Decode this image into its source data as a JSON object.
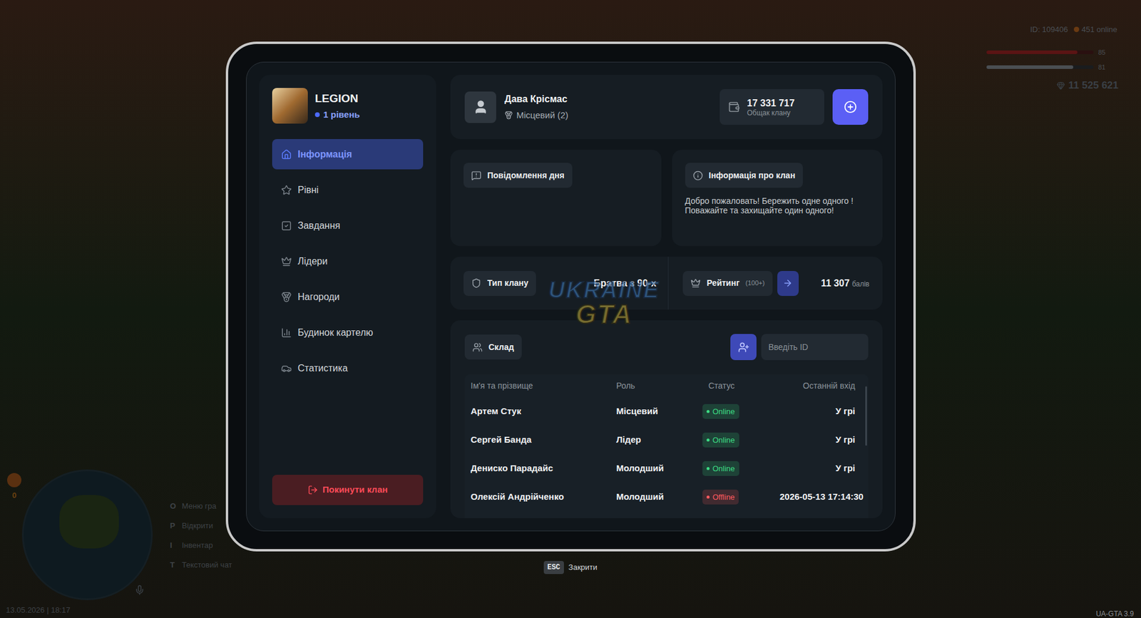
{
  "hud": {
    "id": "ID: 109406",
    "online": "451 online",
    "health": "85",
    "health_level": 0.85,
    "armor": "81",
    "armor_level": 0.81,
    "money": "11 525 621",
    "date": "13.05.2026 | 18:17",
    "version": "UA-GTA 3.9",
    "minimap_counter": "0",
    "hints": [
      {
        "key": "O",
        "label": "Меню гра"
      },
      {
        "key": "P",
        "label": "Відкрити"
      },
      {
        "key": "I",
        "label": "Інвентар"
      },
      {
        "key": "T",
        "label": "Текстовий чат"
      }
    ]
  },
  "clan": {
    "name": "LEGION",
    "level": "1 рівень"
  },
  "sidebar": {
    "items": [
      {
        "label": "Інформація",
        "selected": true
      },
      {
        "label": "Рівні",
        "selected": false
      },
      {
        "label": "Завдання",
        "selected": false
      },
      {
        "label": "Лідери",
        "selected": false
      },
      {
        "label": "Нагороди",
        "selected": false
      },
      {
        "label": "Будинок картелю",
        "selected": false
      },
      {
        "label": "Статистика",
        "selected": false
      }
    ],
    "leave_button": "Покинути клан"
  },
  "profile": {
    "name": "Дава Крісмас",
    "rank": "Місцевий (2)"
  },
  "bank": {
    "amount": "17 331 717",
    "label": "Общак клану"
  },
  "motd": {
    "title": "Повідомлення дня"
  },
  "clan_info": {
    "title": "Інформація про клан",
    "text": "Добро пожаловать! Бережить одне одного ! Поважайте та захищайте один одного!"
  },
  "clan_type": {
    "label": "Тип клану",
    "value": "Братва з 90-х"
  },
  "rating": {
    "label": "Рейтинг",
    "badge": "(100+)",
    "points": "11 307",
    "unit": "балів"
  },
  "roster": {
    "title": "Склад",
    "search_placeholder": "Введіть ID",
    "columns": [
      "Ім'я та прізвище",
      "Роль",
      "Статус",
      "Останній вхід"
    ],
    "rows": [
      {
        "name": "Артем Стук",
        "role": "Місцевий",
        "status": "Online",
        "color": "#3ddc84",
        "last_login": "У грі"
      },
      {
        "name": "Сергей Банда",
        "role": "Лідер",
        "status": "Online",
        "color": "#3ddc84",
        "last_login": "У грі"
      },
      {
        "name": "Дениско Парадайс",
        "role": "Молодший",
        "status": "Online",
        "color": "#3ddc84",
        "last_login": "У грі"
      },
      {
        "name": "Олексій Андрійченко",
        "role": "Молодший",
        "status": "Offline",
        "color": "#ff5a5f",
        "last_login": "2026-05-13 17:14:30"
      }
    ]
  },
  "watermark": {
    "line1": "UKRAINE",
    "line2": "GTA"
  },
  "footer": {
    "key": "ESC",
    "label": "Закрити"
  }
}
